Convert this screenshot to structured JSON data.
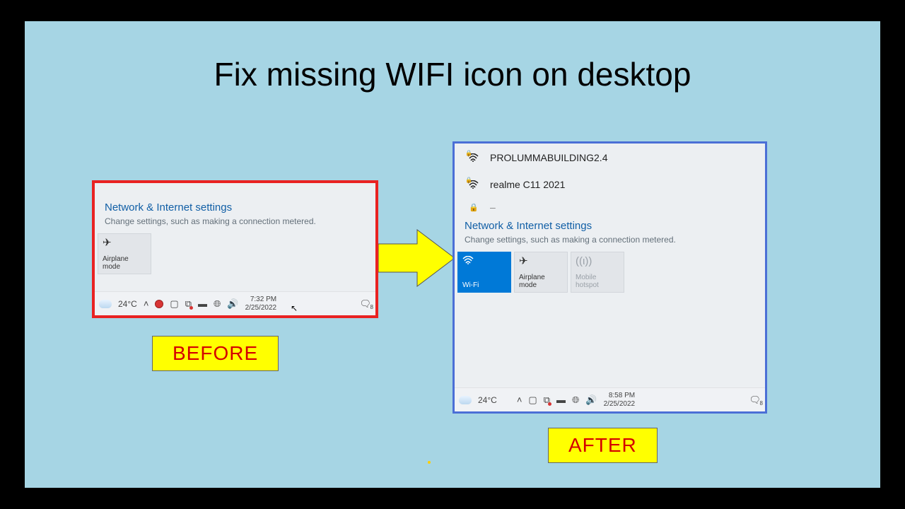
{
  "title": "Fix missing WIFI  icon on desktop",
  "labels": {
    "before": "BEFORE",
    "after": "AFTER"
  },
  "settings": {
    "title": "Network & Internet settings",
    "subtitle": "Change settings, such as making a connection metered."
  },
  "tiles": {
    "wifi": "Wi-Fi",
    "airplane": "Airplane mode",
    "hotspot_l1": "Mobile",
    "hotspot_l2": "hotspot"
  },
  "networks": [
    {
      "name": "PROLUMMABUILDING2.4",
      "locked": true
    },
    {
      "name": "realme C11 2021",
      "locked": true
    }
  ],
  "weather": {
    "temp": "24°C"
  },
  "before_time": {
    "time": "7:32 PM",
    "date": "2/25/2022"
  },
  "after_time": {
    "time": "8:58 PM",
    "date": "2/25/2022"
  },
  "action_center_badge": "8"
}
